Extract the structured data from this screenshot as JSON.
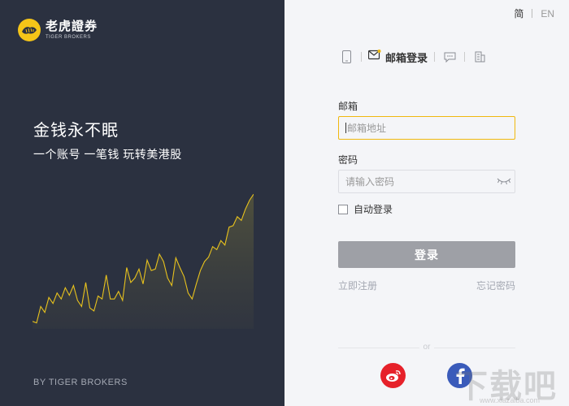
{
  "brand": {
    "name": "老虎證券",
    "subtitle": "TIGER BROKERS"
  },
  "left": {
    "slogan": "金钱永不眠",
    "subslogan": "一个账号 一笔钱 玩转美港股",
    "footer": "BY TIGER BROKERS"
  },
  "lang": {
    "zh": "简",
    "en": "EN"
  },
  "tabs": {
    "phone_icon": "phone-icon",
    "email_label": "邮箱登录",
    "chat_icon": "wechat-icon",
    "building_icon": "building-icon"
  },
  "form": {
    "email_label": "邮箱",
    "email_placeholder": "邮箱地址",
    "password_label": "密码",
    "password_placeholder": "请输入密码",
    "remember_label": "自动登录",
    "submit_label": "登录",
    "register_link": "立即注册",
    "forgot_link": "忘记密码"
  },
  "divider": "or",
  "social": [
    "weibo-icon",
    "facebook-icon"
  ],
  "watermark": {
    "text": "下载吧",
    "sub": "www.xiazaiba.com"
  },
  "colors": {
    "accent": "#f0b80e",
    "panel": "#2b3140",
    "weibo": "#e6212a",
    "facebook": "#3a5bba",
    "button": "#9ea0a6"
  },
  "chart_data": {
    "type": "line",
    "values": [
      10,
      8,
      30,
      22,
      42,
      34,
      48,
      40,
      55,
      45,
      58,
      38,
      30,
      62,
      28,
      24,
      44,
      40,
      72,
      40,
      40,
      50,
      38,
      82,
      62,
      68,
      80,
      60,
      92,
      78,
      80,
      100,
      90,
      68,
      58,
      95,
      82,
      70,
      48,
      40,
      60,
      78,
      90,
      96,
      110,
      106,
      118,
      112,
      136,
      138,
      150,
      145,
      160,
      172,
      180
    ]
  }
}
